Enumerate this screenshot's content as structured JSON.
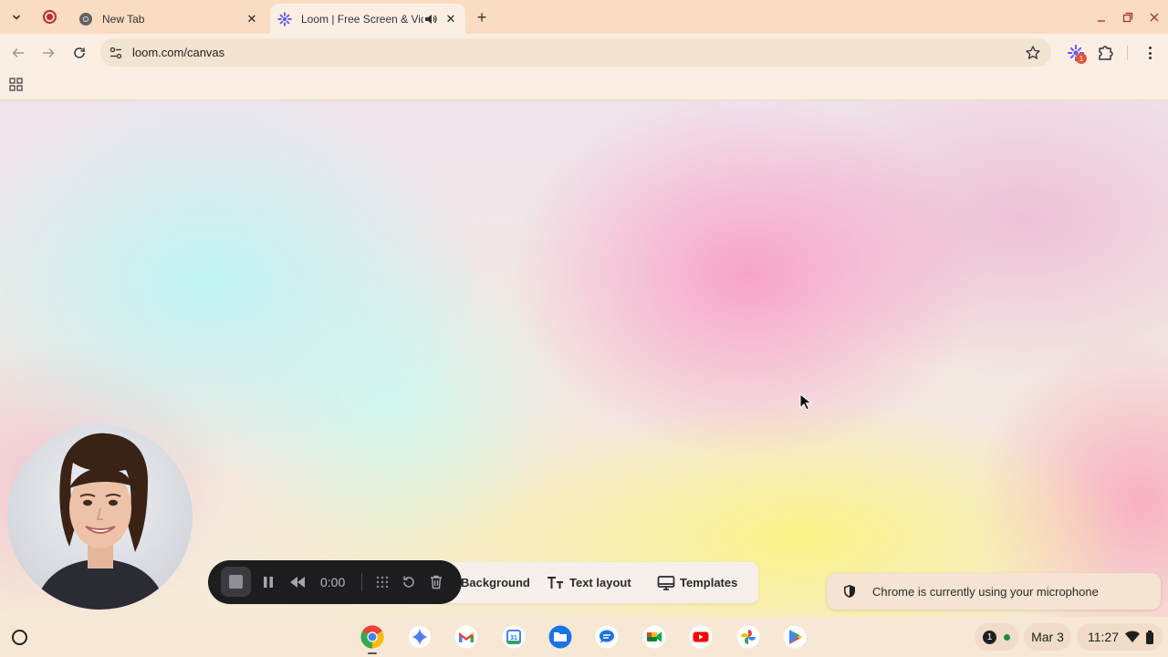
{
  "browser": {
    "tabs": [
      {
        "title": "New Tab",
        "favicon": "chrome-icon"
      },
      {
        "title": "Loom | Free Screen & Video Recording Software",
        "favicon": "loom-icon",
        "audio": true,
        "active": true
      }
    ],
    "url": "loom.com/canvas",
    "extension_badge": "1"
  },
  "loom": {
    "options": {
      "background_label": "Background",
      "text_layout_label": "Text layout",
      "templates_label": "Templates"
    },
    "recorder": {
      "timer": "0:00"
    }
  },
  "toast": {
    "message": "Chrome is currently using your microphone"
  },
  "shelf": {
    "apps": [
      "chrome-icon",
      "gemini-icon",
      "gmail-icon",
      "calendar-icon",
      "files-icon",
      "messages-icon",
      "meet-icon",
      "youtube-icon",
      "photos-icon",
      "play-store-icon"
    ],
    "calendar_day": "31",
    "notification_count": "1",
    "date": "Mar 3",
    "time": "11:27"
  }
}
